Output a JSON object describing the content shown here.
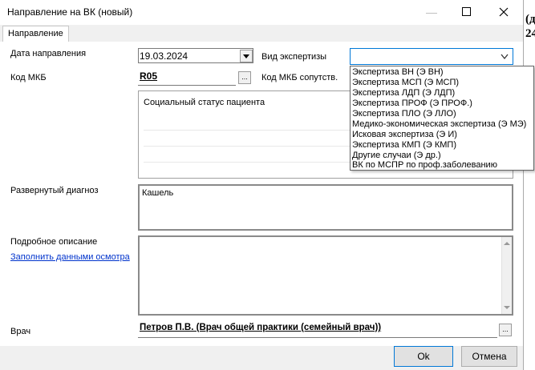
{
  "background_window": {
    "text_line1": "(д",
    "text_line2": "24"
  },
  "dialog": {
    "title": "Направление на ВК (новый)",
    "minimize_glyph": "—",
    "maximize_glyph": "☐",
    "close_glyph": "✕",
    "tab": "Направление"
  },
  "form": {
    "date_label": "Дата направления",
    "date_value": "19.03.2024",
    "mkb_label": "Код МКБ",
    "mkb_value": "R05",
    "expertise_label": "Вид экспертизы",
    "expertise_value": "",
    "mkb_related_label": "Код МКБ сопутств.",
    "social_status_header": "Социальный статус пациента",
    "diagnosis_label": "Развернутый диагноз",
    "diagnosis_value": "Кашель",
    "description_label": "Подробное описание",
    "fill_link": "Заполнить данными осмотра",
    "description_value": "",
    "doctor_label": "Врач",
    "doctor_value": "Петров П.В. (Врач общей практики (семейный врач))",
    "ellipsis": "..."
  },
  "dropdown_options": [
    "Экспертиза ВН (Э ВН)",
    "Экспертиза МСП (Э МСП)",
    "Экспертиза ЛДП (Э ЛДП)",
    "Экспертиза ПРОФ (Э ПРОФ.)",
    "Экспертиза ПЛО (Э ЛЛО)",
    "Медико-экономическая экспертиза (Э МЭ)",
    "Исковая экспертиза (Э И)",
    "Экспертиза КМП (Э КМП)",
    "Другие случаи (Э др.)",
    "ВК по МСПР по проф.заболеванию"
  ],
  "buttons": {
    "ok": "Ok",
    "cancel": "Отмена"
  }
}
